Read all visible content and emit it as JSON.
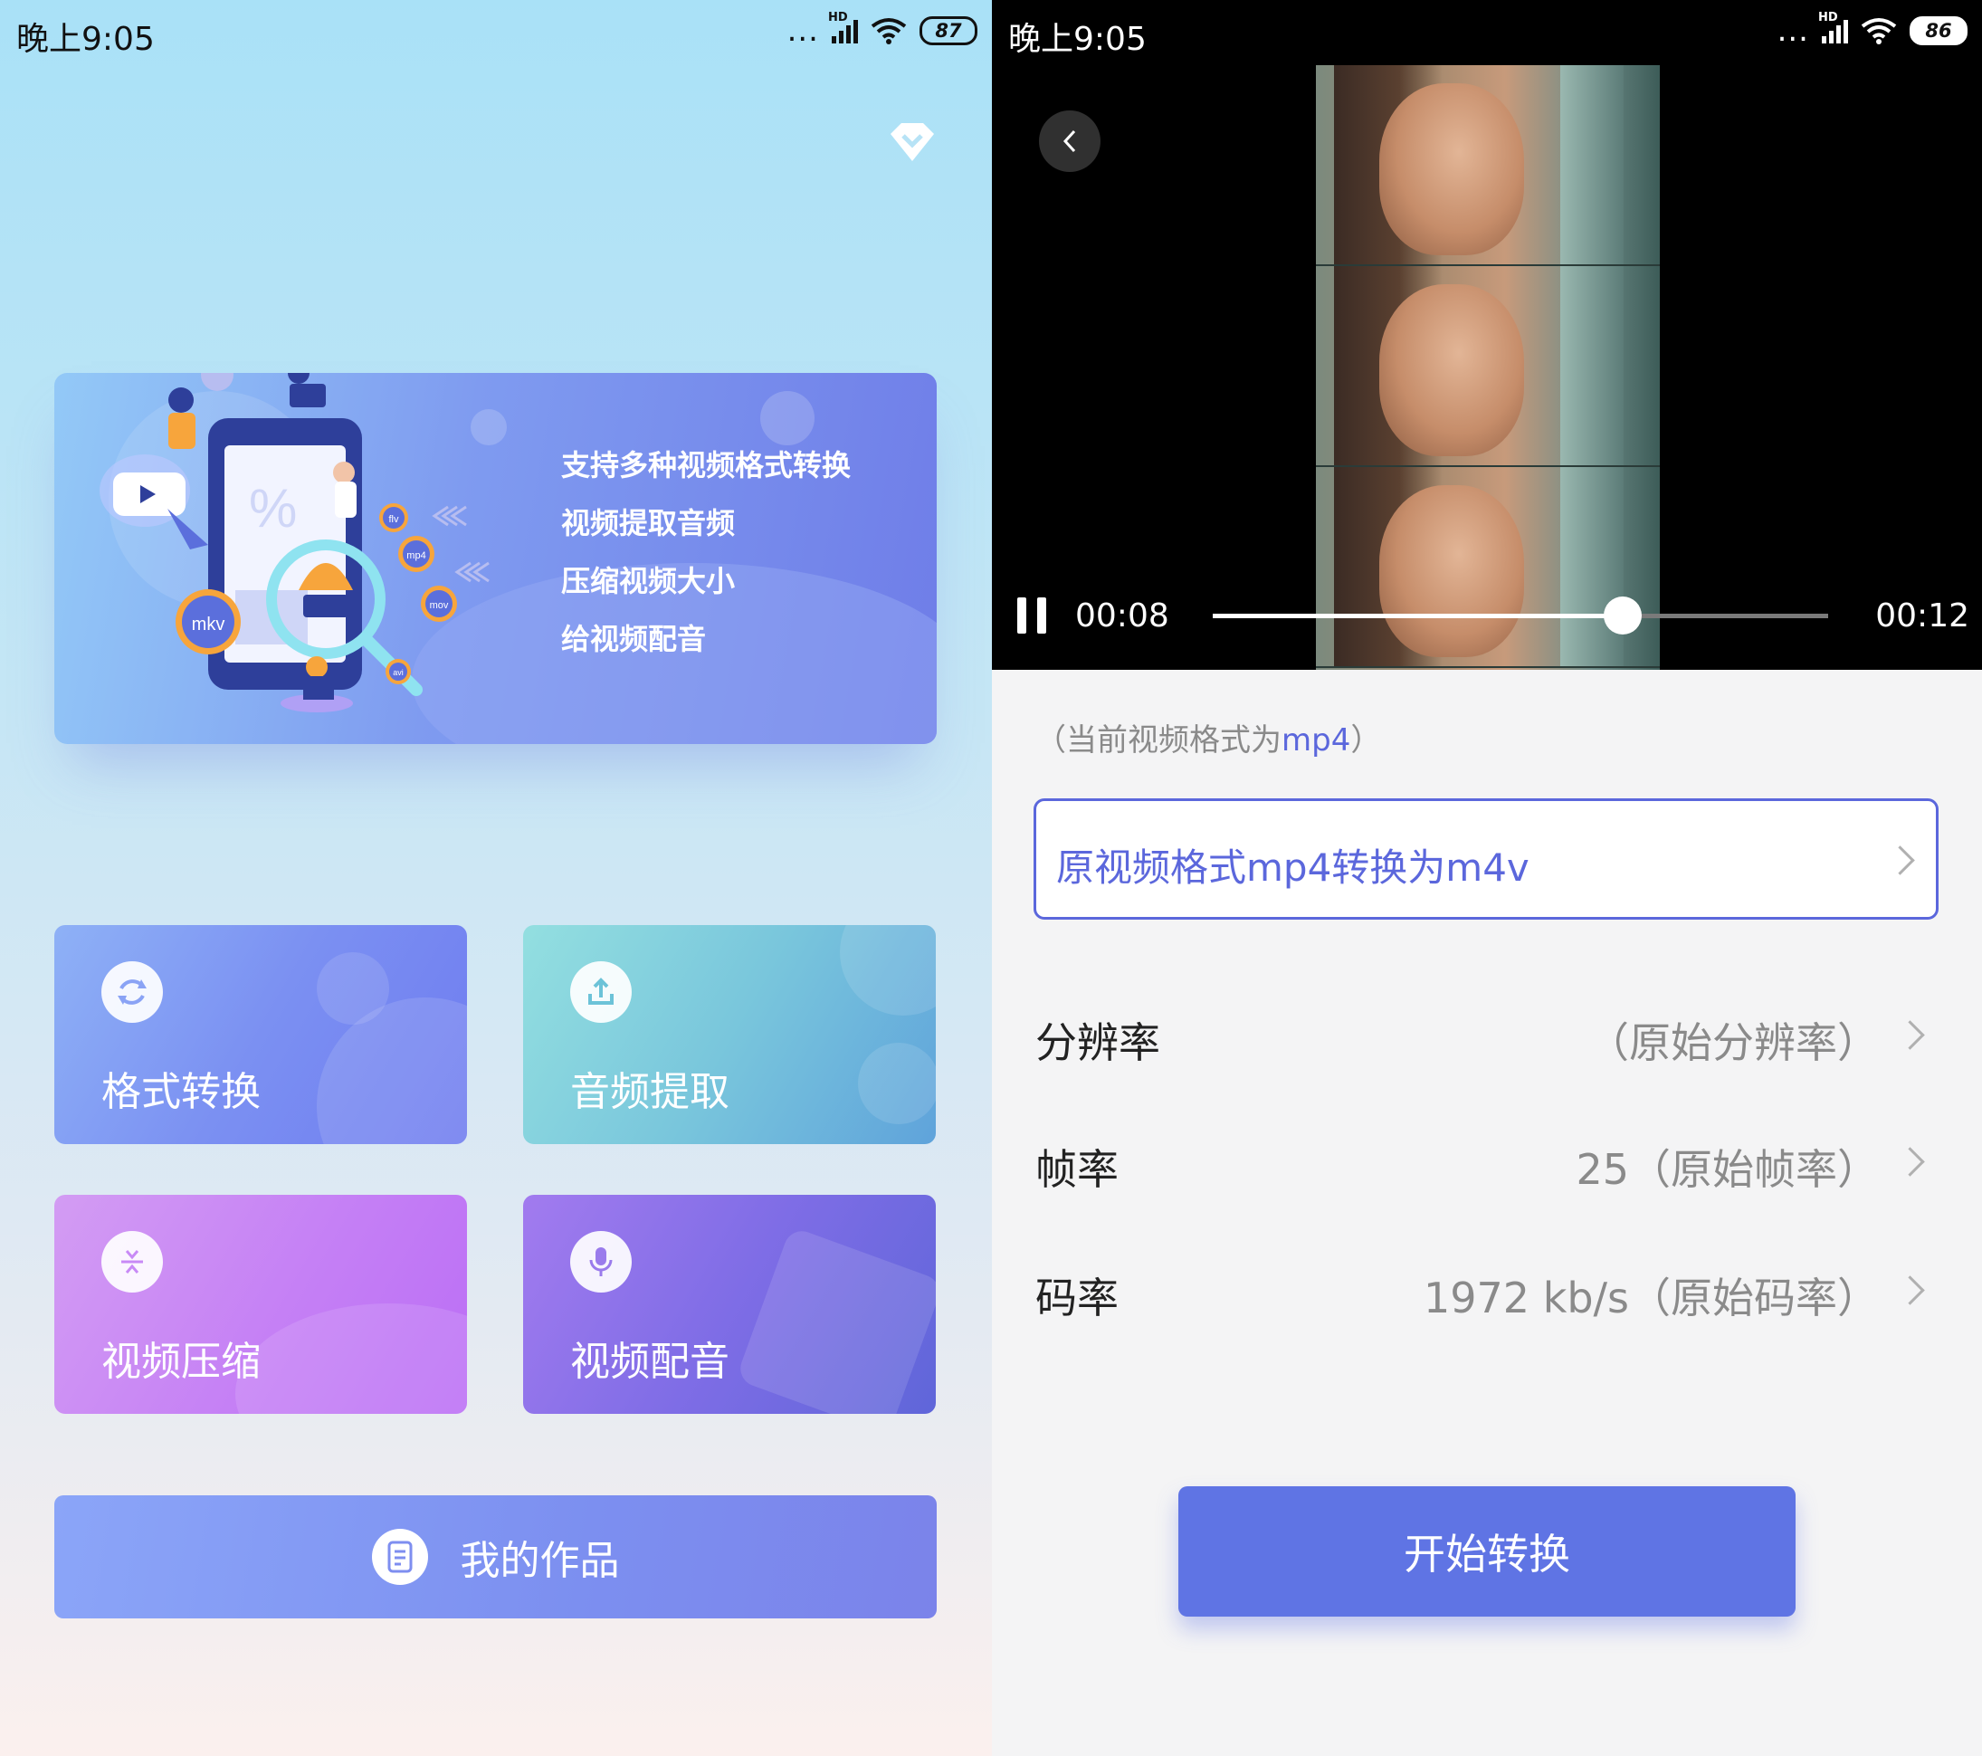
{
  "left": {
    "status": {
      "time": "晚上9:05",
      "dots": "...",
      "hd": "HD",
      "battery": "87"
    },
    "banner": {
      "lines": [
        "支持多种视频格式转换",
        "视频提取音频",
        "压缩视频大小",
        "给视频配音"
      ],
      "badges": [
        "mkv",
        "flv",
        "mp4",
        "mov",
        "avi"
      ]
    },
    "tiles": [
      {
        "label": "格式转换",
        "icon": "refresh-icon"
      },
      {
        "label": "音频提取",
        "icon": "upload-icon"
      },
      {
        "label": "视频压缩",
        "icon": "compress-icon"
      },
      {
        "label": "视频配音",
        "icon": "microphone-icon"
      }
    ],
    "works": {
      "label": "我的作品",
      "icon": "document-icon"
    },
    "vip_icon": "diamond-icon"
  },
  "right": {
    "status": {
      "time": "晚上9:05",
      "dots": "...",
      "hd": "HD",
      "battery": "86"
    },
    "player": {
      "current": "00:08",
      "total": "00:12",
      "progress": 0.666
    },
    "current_format": {
      "prefix": "（当前视频格式为",
      "value": "mp4",
      "suffix": "）"
    },
    "convert": {
      "label": "原视频格式mp4转换为m4v"
    },
    "settings": [
      {
        "label": "分辨率",
        "value": "（原始分辨率）"
      },
      {
        "label": "帧率",
        "value": "25（原始帧率）"
      },
      {
        "label": "码率",
        "value": "1972 kb/s（原始码率）"
      }
    ],
    "start_button": "开始转换"
  },
  "colors": {
    "accent": "#5f74e4",
    "highlight": "#5b67dc"
  }
}
